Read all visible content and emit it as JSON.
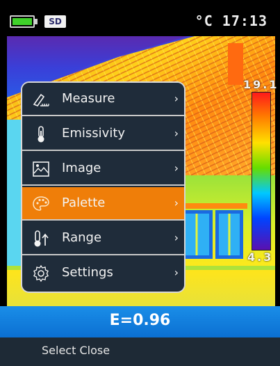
{
  "status": {
    "sd_label": "SD",
    "unit_time": "°C 17:13",
    "battery_color": "#3fd12a"
  },
  "scale": {
    "max": "19.1",
    "min": "4.3"
  },
  "emissivity_readout": "E=0.96",
  "menu": {
    "items": [
      {
        "label": "Measure",
        "icon": "measure-icon",
        "selected": false
      },
      {
        "label": "Emissivity",
        "icon": "thermometer-icon",
        "selected": false
      },
      {
        "label": "Image",
        "icon": "image-icon",
        "selected": false
      },
      {
        "label": "Palette",
        "icon": "palette-icon",
        "selected": true
      },
      {
        "label": "Range",
        "icon": "range-icon",
        "selected": false
      },
      {
        "label": "Settings",
        "icon": "gear-icon",
        "selected": false
      }
    ],
    "chevron": "›",
    "selected_color": "#ef7e09"
  },
  "softkeys": "Select Close"
}
